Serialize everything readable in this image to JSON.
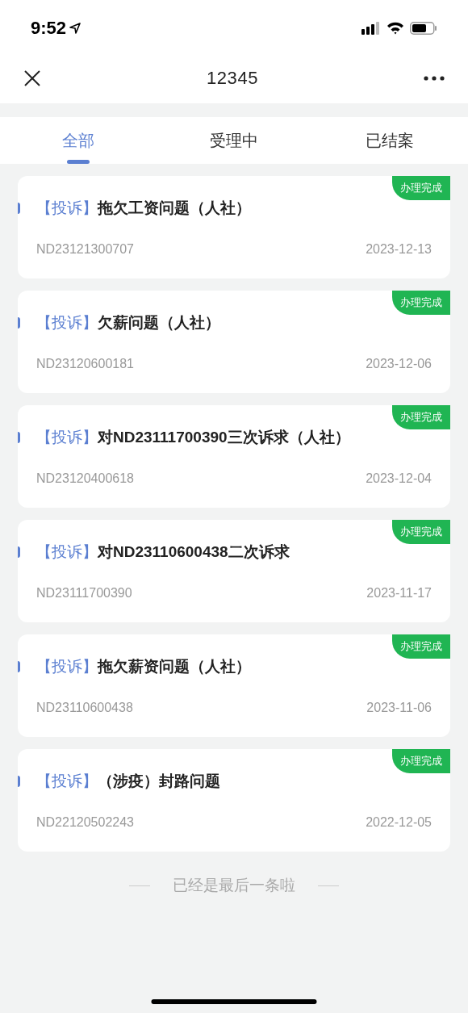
{
  "status_bar": {
    "time": "9:52"
  },
  "header": {
    "title": "12345"
  },
  "tabs": [
    {
      "label": "全部",
      "selected": true
    },
    {
      "label": "受理中",
      "selected": false
    },
    {
      "label": "已结案",
      "selected": false
    }
  ],
  "cases": [
    {
      "category": "【投诉】",
      "title": "拖欠工资问题（人社）",
      "number": "ND23121300707",
      "date": "2023-12-13",
      "status": "办理完成"
    },
    {
      "category": "【投诉】",
      "title": "欠薪问题（人社）",
      "number": "ND23120600181",
      "date": "2023-12-06",
      "status": "办理完成"
    },
    {
      "category": "【投诉】",
      "title": "对ND23111700390三次诉求（人社）",
      "number": "ND23120400618",
      "date": "2023-12-04",
      "status": "办理完成"
    },
    {
      "category": "【投诉】",
      "title": "对ND23110600438二次诉求",
      "number": "ND23111700390",
      "date": "2023-11-17",
      "status": "办理完成"
    },
    {
      "category": "【投诉】",
      "title": "拖欠薪资问题（人社）",
      "number": "ND23110600438",
      "date": "2023-11-06",
      "status": "办理完成"
    },
    {
      "category": "【投诉】",
      "title": "（涉疫）封路问题",
      "number": "ND22120502243",
      "date": "2022-12-05",
      "status": "办理完成"
    }
  ],
  "footer": {
    "text": "已经是最后一条啦"
  }
}
